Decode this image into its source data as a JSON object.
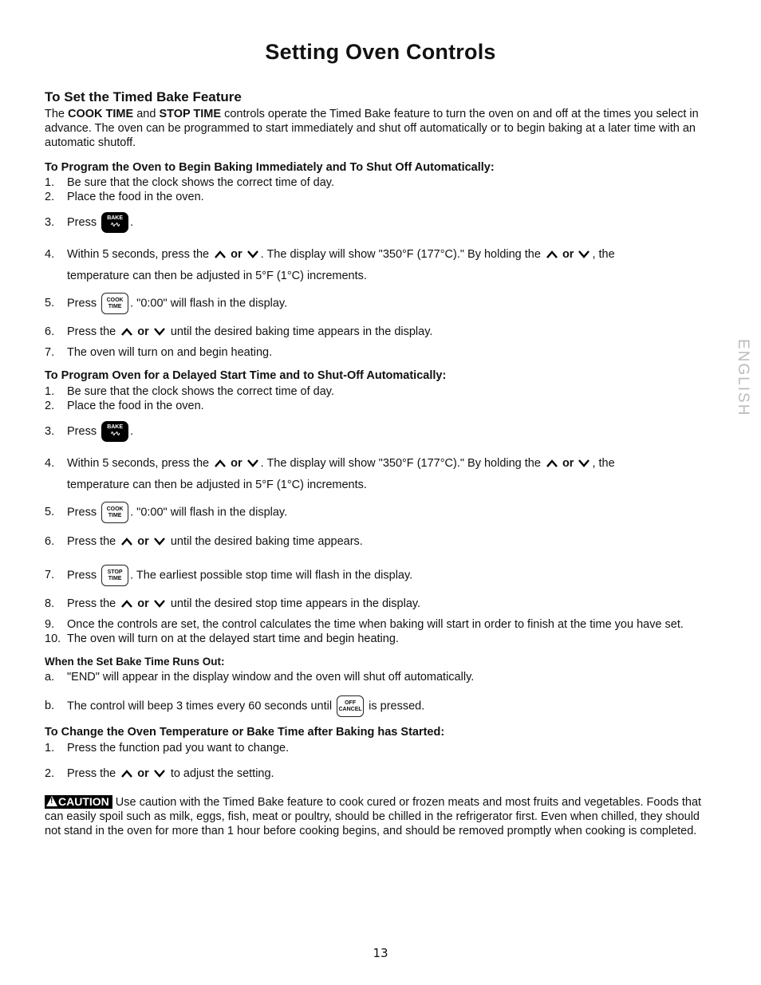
{
  "page": {
    "title": "Setting Oven Controls",
    "page_number": "13",
    "side_tab": "ENGLISH"
  },
  "timed_bake": {
    "heading": "To Set the Timed Bake Feature",
    "intro": {
      "pre": "The ",
      "kw1": "COOK TIME",
      "mid": " and ",
      "kw2": "STOP TIME",
      "post": " controls operate the Timed Bake feature to turn the oven on and off at the times you select in advance. The oven can be programmed to start immediately and shut off automatically or to begin baking at a later time with an automatic shutoff."
    }
  },
  "icons": {
    "up": "up-arrow-icon",
    "down": "down-arrow-icon",
    "or": "or",
    "bake_pad": "BAKE",
    "cook_time_pad": [
      "COOK",
      "TIME"
    ],
    "stop_time_pad": [
      "STOP",
      "TIME"
    ],
    "off_cancel_pad": [
      "OFF",
      "CANCEL"
    ]
  },
  "immediate": {
    "heading": "To Program the Oven to Begin Baking Immediately and To Shut Off Automatically:",
    "s1": "Be sure that the clock shows the correct time of day.",
    "s2": "Place the food in the oven.",
    "s3_pre": "Press",
    "s3_post": ".",
    "s4_a": "Within 5 seconds, press the",
    "s4_b": ". The display will show \"350°F (177°C).\" By holding the",
    "s4_c": ", the",
    "s4_cont": "temperature can then be adjusted in 5°F (1°C) increments.",
    "s5_pre": "Press",
    "s5_post": ". \"0:00\" will flash in the display.",
    "s6_pre": "Press the",
    "s6_post": "until the desired baking time appears in the display.",
    "s7": "The oven will turn on and begin heating."
  },
  "delayed": {
    "heading": "To Program Oven for a Delayed Start Time and to Shut-Off Automatically:",
    "s1": "Be sure that the clock shows the correct time of day.",
    "s2": "Place the food in the oven.",
    "s3_pre": "Press",
    "s3_post": ".",
    "s4_a": "Within 5 seconds, press the",
    "s4_b": ". The display will show \"350°F (177°C).\" By holding the",
    "s4_c": ", the",
    "s4_cont": "temperature can then be adjusted in 5°F (1°C) increments.",
    "s5_pre": "Press",
    "s5_post": ". \"0:00\" will flash in the display.",
    "s6_pre": "Press the",
    "s6_post": "until the desired baking time appears.",
    "s7_pre": "Press",
    "s7_post": ". The earliest possible stop time will flash in the display.",
    "s8_pre": "Press the",
    "s8_post": "until the desired stop time appears in the display.",
    "s9": "Once the controls are set, the control calculates the time when baking will start in order to finish at the time you have set.",
    "s10": "The oven will turn on at the delayed start time and begin heating."
  },
  "runs_out": {
    "heading": "When the Set Bake Time Runs Out:",
    "a": "\"END\" will appear in the display window and the oven will shut off automatically.",
    "b_pre": "The control will beep 3 times every 60 seconds until",
    "b_post": "is pressed."
  },
  "change": {
    "heading": "To Change the Oven Temperature or Bake Time after Baking has Started:",
    "s1": "Press the function pad you want to change.",
    "s2_pre": "Press the",
    "s2_post": "to adjust the setting."
  },
  "caution": {
    "badge": "CAUTION",
    "text": "Use caution with the Timed Bake feature to cook cured or frozen meats and most fruits and vegetables. Foods that can easily spoil such as milk, eggs, fish, meat or poultry, should be chilled in the refrigerator first. Even when chilled, they should not stand in the oven for more than 1 hour before cooking begins, and should be removed promptly when cooking is completed."
  },
  "labels": {
    "n1": "1.",
    "n2": "2.",
    "n3": "3.",
    "n4": "4.",
    "n5": "5.",
    "n6": "6.",
    "n7": "7.",
    "n8": "8.",
    "n9": "9.",
    "n10": "10.",
    "a": "a.",
    "b": "b."
  }
}
